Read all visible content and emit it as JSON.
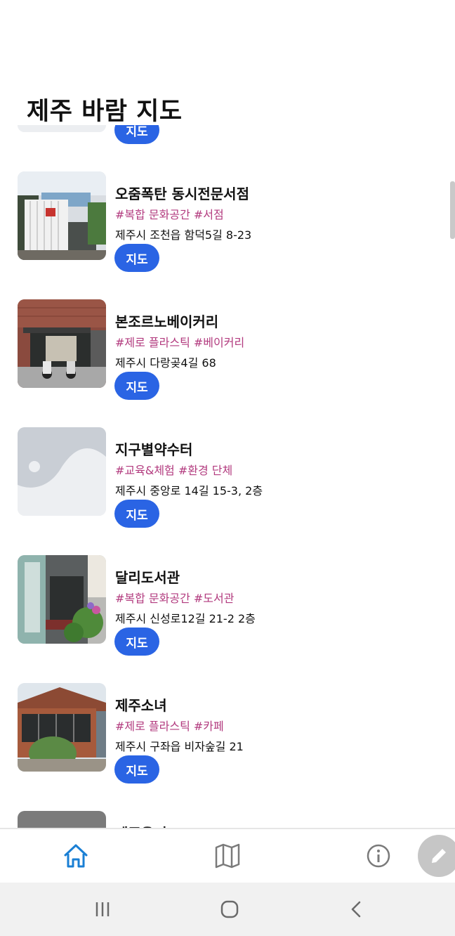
{
  "app": {
    "title": "제주 바람 지도"
  },
  "list": {
    "items": [
      {
        "name": "",
        "tags": "",
        "address": "",
        "map_label": "지도"
      },
      {
        "name": "오줌폭탄 동시전문서점",
        "tags": "#복합 문화공간 #서점",
        "address": "제주시 조천읍 함덕5길 8-23",
        "map_label": "지도"
      },
      {
        "name": "본조르노베이커리",
        "tags": "#제로 플라스틱 #베이커리",
        "address": "제주시 다랑곶4길 68",
        "map_label": "지도"
      },
      {
        "name": "지구별약수터",
        "tags": "#교육&체험 #환경 단체",
        "address": "제주시 중앙로 14길 15-3, 2층",
        "map_label": "지도"
      },
      {
        "name": "달리도서관",
        "tags": "#복합 문화공간 #도서관",
        "address": "제주시 신성로12길 21-2 2층",
        "map_label": "지도"
      },
      {
        "name": "제주소녀",
        "tags": "#제로 플라스틱 #카페",
        "address": "제주시 구좌읍 비자숲길 21",
        "map_label": "지도"
      },
      {
        "name": "제주용기",
        "tags": "",
        "address": "",
        "map_label": ""
      }
    ]
  },
  "bottom_nav": {
    "items": [
      {
        "icon": "home-icon",
        "active": true
      },
      {
        "icon": "map-icon",
        "active": false
      },
      {
        "icon": "info-icon",
        "active": false
      }
    ],
    "fab_icon": "pencil-icon"
  },
  "system_nav": {
    "buttons": [
      "recent-apps-icon",
      "home-circle-icon",
      "back-chevron-icon"
    ]
  },
  "colors": {
    "accent": "#2a64e4",
    "tag": "#b23a7e",
    "active_nav": "#1a7fd4",
    "inactive_nav": "#7a7a7a",
    "fab": "#c6c6c6"
  }
}
